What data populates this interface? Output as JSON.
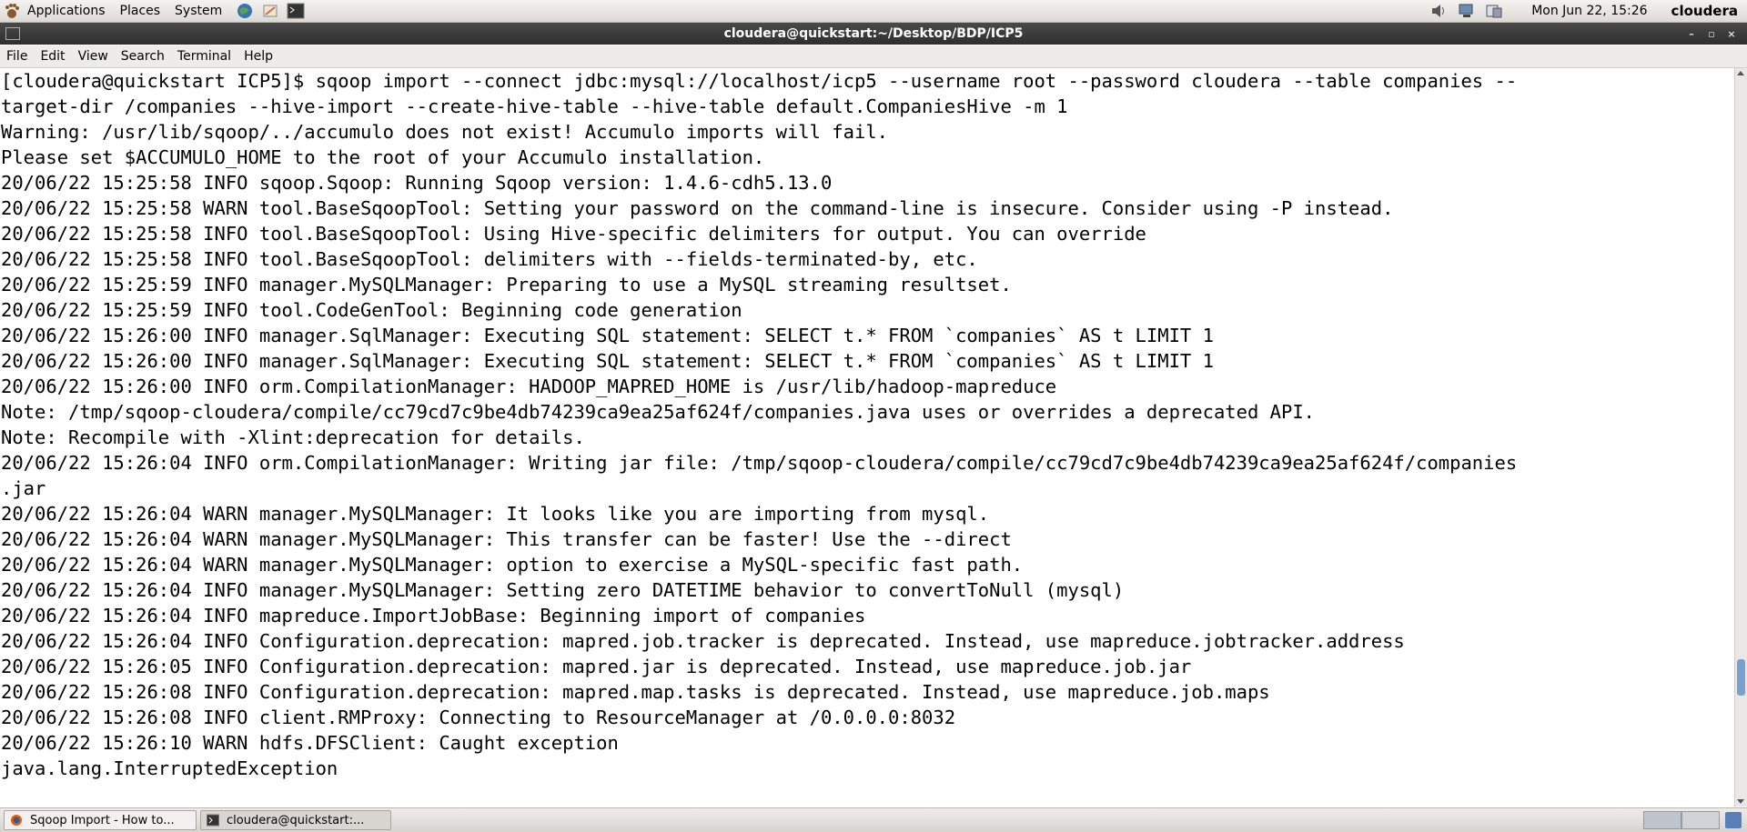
{
  "top_panel": {
    "menus": [
      "Applications",
      "Places",
      "System"
    ],
    "launchers": [
      "browser-globe-icon",
      "text-editor-icon",
      "terminal-launcher-icon"
    ],
    "tray": [
      "volume-icon",
      "network-icon",
      "display-icon"
    ],
    "clock": "Mon Jun 22, 15:26",
    "user": "cloudera"
  },
  "window": {
    "title": "cloudera@quickstart:~/Desktop/BDP/ICP5",
    "controls": [
      "–",
      "▫",
      "×"
    ]
  },
  "menubar": [
    "File",
    "Edit",
    "View",
    "Search",
    "Terminal",
    "Help"
  ],
  "terminal": {
    "lines": [
      "[cloudera@quickstart ICP5]$ sqoop import --connect jdbc:mysql://localhost/icp5 --username root --password cloudera --table companies --",
      "target-dir /companies --hive-import --create-hive-table --hive-table default.CompaniesHive -m 1",
      "Warning: /usr/lib/sqoop/../accumulo does not exist! Accumulo imports will fail.",
      "Please set $ACCUMULO_HOME to the root of your Accumulo installation.",
      "20/06/22 15:25:58 INFO sqoop.Sqoop: Running Sqoop version: 1.4.6-cdh5.13.0",
      "20/06/22 15:25:58 WARN tool.BaseSqoopTool: Setting your password on the command-line is insecure. Consider using -P instead.",
      "20/06/22 15:25:58 INFO tool.BaseSqoopTool: Using Hive-specific delimiters for output. You can override",
      "20/06/22 15:25:58 INFO tool.BaseSqoopTool: delimiters with --fields-terminated-by, etc.",
      "20/06/22 15:25:59 INFO manager.MySQLManager: Preparing to use a MySQL streaming resultset.",
      "20/06/22 15:25:59 INFO tool.CodeGenTool: Beginning code generation",
      "20/06/22 15:26:00 INFO manager.SqlManager: Executing SQL statement: SELECT t.* FROM `companies` AS t LIMIT 1",
      "20/06/22 15:26:00 INFO manager.SqlManager: Executing SQL statement: SELECT t.* FROM `companies` AS t LIMIT 1",
      "20/06/22 15:26:00 INFO orm.CompilationManager: HADOOP_MAPRED_HOME is /usr/lib/hadoop-mapreduce",
      "Note: /tmp/sqoop-cloudera/compile/cc79cd7c9be4db74239ca9ea25af624f/companies.java uses or overrides a deprecated API.",
      "Note: Recompile with -Xlint:deprecation for details.",
      "20/06/22 15:26:04 INFO orm.CompilationManager: Writing jar file: /tmp/sqoop-cloudera/compile/cc79cd7c9be4db74239ca9ea25af624f/companies",
      ".jar",
      "20/06/22 15:26:04 WARN manager.MySQLManager: It looks like you are importing from mysql.",
      "20/06/22 15:26:04 WARN manager.MySQLManager: This transfer can be faster! Use the --direct",
      "20/06/22 15:26:04 WARN manager.MySQLManager: option to exercise a MySQL-specific fast path.",
      "20/06/22 15:26:04 INFO manager.MySQLManager: Setting zero DATETIME behavior to convertToNull (mysql)",
      "20/06/22 15:26:04 INFO mapreduce.ImportJobBase: Beginning import of companies",
      "20/06/22 15:26:04 INFO Configuration.deprecation: mapred.job.tracker is deprecated. Instead, use mapreduce.jobtracker.address",
      "20/06/22 15:26:05 INFO Configuration.deprecation: mapred.jar is deprecated. Instead, use mapreduce.job.jar",
      "20/06/22 15:26:08 INFO Configuration.deprecation: mapred.map.tasks is deprecated. Instead, use mapreduce.job.maps",
      "20/06/22 15:26:08 INFO client.RMProxy: Connecting to ResourceManager at /0.0.0.0:8032",
      "20/06/22 15:26:10 WARN hdfs.DFSClient: Caught exception",
      "java.lang.InterruptedException"
    ]
  },
  "taskbar": {
    "tasks": [
      {
        "label": "Sqoop Import - How to...",
        "icon": "firefox-icon"
      },
      {
        "label": "cloudera@quickstart:...",
        "icon": "terminal-icon"
      }
    ]
  }
}
